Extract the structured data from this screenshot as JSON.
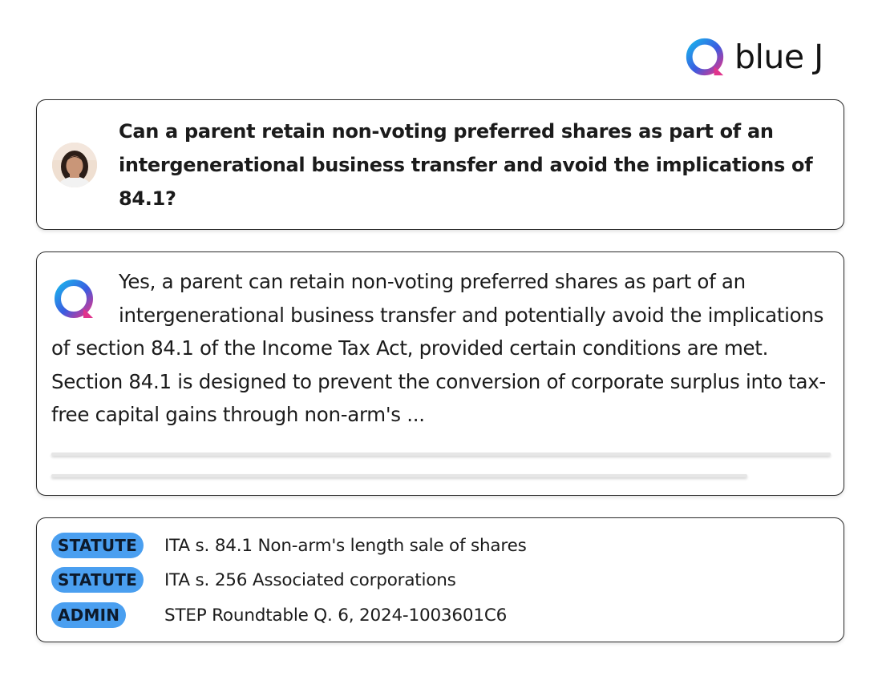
{
  "brand": {
    "name": "blue J",
    "logo_icon": "bluej-logo-icon",
    "gradient": [
      "#1e9be8",
      "#3b5be0",
      "#e0348c"
    ]
  },
  "question": {
    "avatar_icon": "user-avatar",
    "text": "Can a parent retain non-voting preferred shares as part of an intergenerational business transfer and avoid the implications of 84.1?"
  },
  "answer": {
    "icon": "bluej-answer-icon",
    "text": "Yes, a parent can retain non-voting preferred shares as part of an intergenerational business transfer and potentially avoid the implications of section 84.1 of the Income Tax Act, provided certain conditions are met. Section 84.1 is designed to prevent the conversion of corporate surplus into tax-free capital gains through non-arm's ..."
  },
  "sources": [
    {
      "type": "STATUTE",
      "title": "ITA s. 84.1 Non-arm's length sale of shares"
    },
    {
      "type": "STATUTE",
      "title": "ITA s. 256 Associated corporations"
    },
    {
      "type": "ADMIN",
      "title": "STEP Roundtable Q. 6, 2024-1003601C6"
    }
  ],
  "colors": {
    "badge_bg": "#4a9ff0",
    "card_border": "#2a2a2a",
    "text": "#1b1b1b"
  }
}
